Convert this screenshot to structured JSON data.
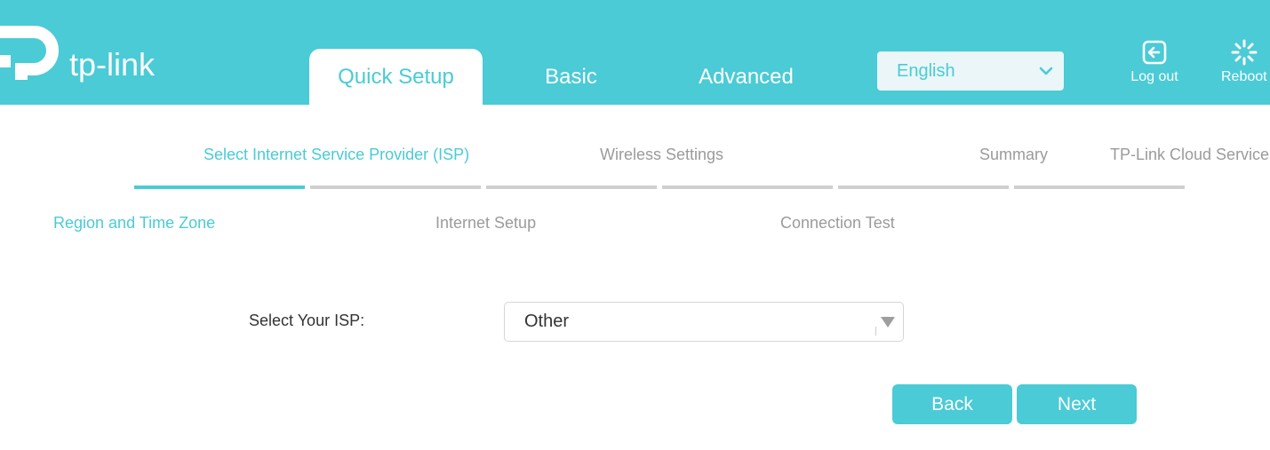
{
  "header": {
    "logo_text": "tp-link",
    "tabs": [
      {
        "label": "Quick Setup",
        "active": true
      },
      {
        "label": "Basic",
        "active": false
      },
      {
        "label": "Advanced",
        "active": false
      }
    ],
    "language": {
      "selected": "English"
    },
    "logout_label": "Log out",
    "reboot_label": "Reboot"
  },
  "steps": [
    {
      "label": "Select Internet Service Provider (ISP)",
      "active": true
    },
    {
      "label": "Wireless Settings",
      "active": false
    },
    {
      "label": "Summary",
      "active": false
    },
    {
      "label": "TP-Link Cloud Service",
      "active": false
    }
  ],
  "substeps": [
    {
      "label": "Region and Time Zone",
      "active": true
    },
    {
      "label": "Internet Setup",
      "active": false
    },
    {
      "label": "Connection Test",
      "active": false
    }
  ],
  "form": {
    "isp_label": "Select Your ISP:",
    "isp_value": "Other"
  },
  "buttons": {
    "back": "Back",
    "next": "Next"
  },
  "colors": {
    "accent": "#4acbd6",
    "inactive_text": "#9b9b9b",
    "inactive_bar": "#cfcfcf"
  },
  "icons": {
    "logo": "tp-link-logo-icon",
    "language_dropdown": "chevron-down-icon",
    "logout": "logout-icon",
    "reboot": "reboot-icon",
    "isp_dropdown": "triangle-down-icon"
  }
}
